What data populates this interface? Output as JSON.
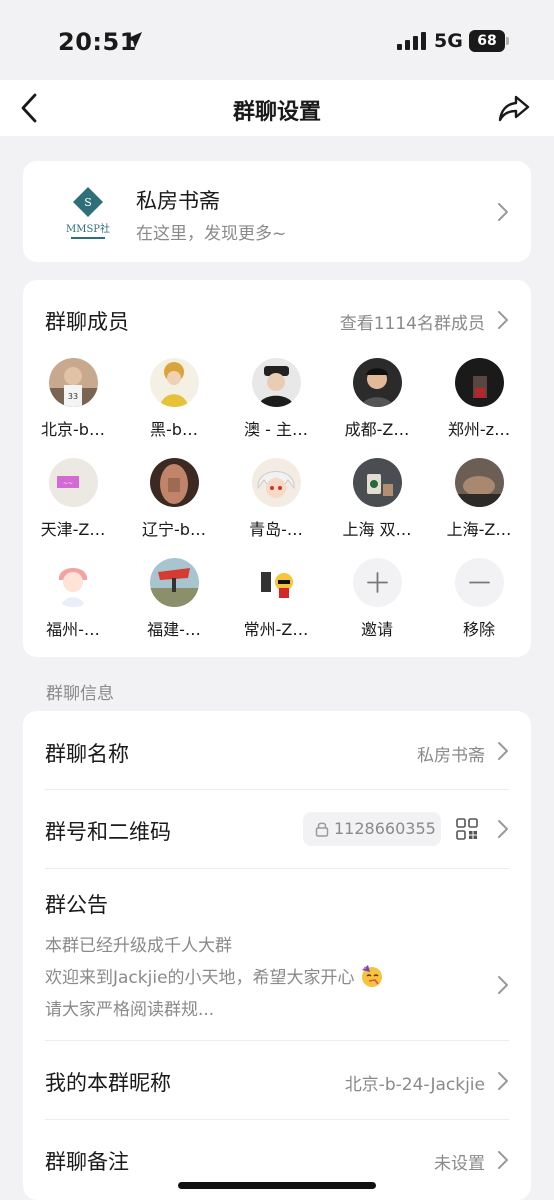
{
  "status_bar": {
    "time": "20:51",
    "network": "5G",
    "battery": "68"
  },
  "nav": {
    "title": "群聊设置"
  },
  "group": {
    "name": "私房书斋",
    "subtitle": "在这里，发现更多~",
    "logo_text": "MMSP社"
  },
  "members": {
    "title": "群聊成员",
    "view_all": "查看1114名群成员",
    "list": [
      {
        "name": "北京-b…"
      },
      {
        "name": "黑-b…"
      },
      {
        "name": "澳 - 主…"
      },
      {
        "name": "成都-Z…"
      },
      {
        "name": "郑州-z…"
      },
      {
        "name": "天津-Z…"
      },
      {
        "name": "辽宁-b…"
      },
      {
        "name": "青岛-…"
      },
      {
        "name": "上海 双…"
      },
      {
        "name": "上海-Z…"
      },
      {
        "name": "福州-…"
      },
      {
        "name": "福建-…"
      },
      {
        "name": "常州-Z…"
      }
    ],
    "invite_label": "邀请",
    "remove_label": "移除"
  },
  "info_section": {
    "label": "群聊信息",
    "group_name": {
      "label": "群聊名称",
      "value": "私房书斋"
    },
    "group_id": {
      "label": "群号和二维码",
      "value": "1128660355"
    },
    "notice": {
      "label": "群公告",
      "line1": "本群已经升级成千人大群",
      "line2": "欢迎来到Jackjie的小天地，希望大家开心",
      "line3": "请大家严格阅读群规..."
    },
    "my_nickname": {
      "label": "我的本群昵称",
      "value": "北京-b-24-Jackjie"
    },
    "remark": {
      "label": "群聊备注",
      "value": "未设置"
    }
  }
}
